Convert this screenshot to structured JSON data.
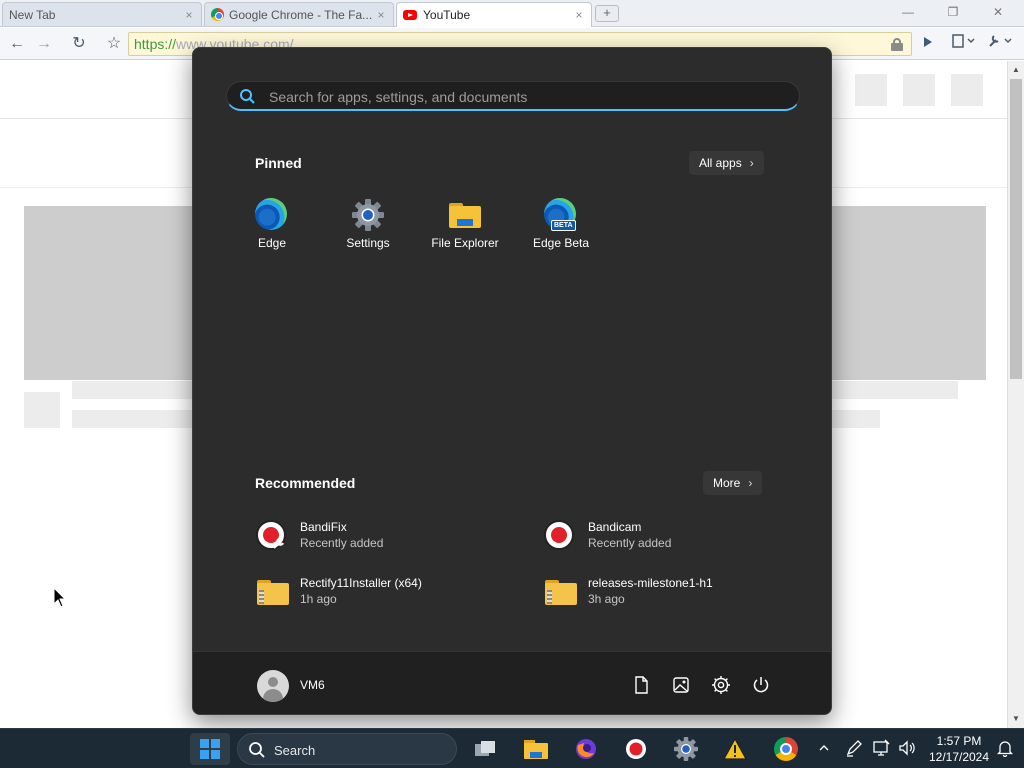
{
  "browser": {
    "tabs": [
      {
        "title": "New Tab",
        "close": "×"
      },
      {
        "title": "Google Chrome - The Fa...",
        "close": "×"
      },
      {
        "title": "YouTube",
        "close": "×"
      }
    ],
    "new_tab_glyph": "+",
    "window_controls": {
      "minimize": "—",
      "restore": "❐",
      "close": "✕"
    },
    "toolbar": {
      "back": "←",
      "forward": "→",
      "reload": "↻",
      "star": "☆"
    },
    "url_scheme": "https://",
    "url_rest": "www.youtube.com/"
  },
  "start_menu": {
    "search_placeholder": "Search for apps, settings, and documents",
    "pinned_title": "Pinned",
    "all_apps_label": "All apps",
    "chevron": "›",
    "pinned": [
      {
        "label": "Edge",
        "icon": "edge-icon"
      },
      {
        "label": "Settings",
        "icon": "settings-gear-icon"
      },
      {
        "label": "File Explorer",
        "icon": "folder-icon"
      },
      {
        "label": "Edge Beta",
        "icon": "edge-beta-icon",
        "badge": "BETA"
      }
    ],
    "recommended_title": "Recommended",
    "more_label": "More",
    "recommended": [
      {
        "name": "BandiFix",
        "sub": "Recently added",
        "icon": "bandifix-icon"
      },
      {
        "name": "Bandicam",
        "sub": "Recently added",
        "icon": "bandicam-icon"
      },
      {
        "name": "Rectify11Installer (x64)",
        "sub": "1h ago",
        "icon": "zip-folder-icon"
      },
      {
        "name": "releases-milestone1-h1",
        "sub": "3h ago",
        "icon": "zip-folder-icon"
      }
    ],
    "user_name": "VM6"
  },
  "taskbar": {
    "search_label": "Search",
    "time": "1:57 PM",
    "date": "12/17/2024",
    "tray_chevron": "^",
    "accent": "#3aa0f0"
  }
}
